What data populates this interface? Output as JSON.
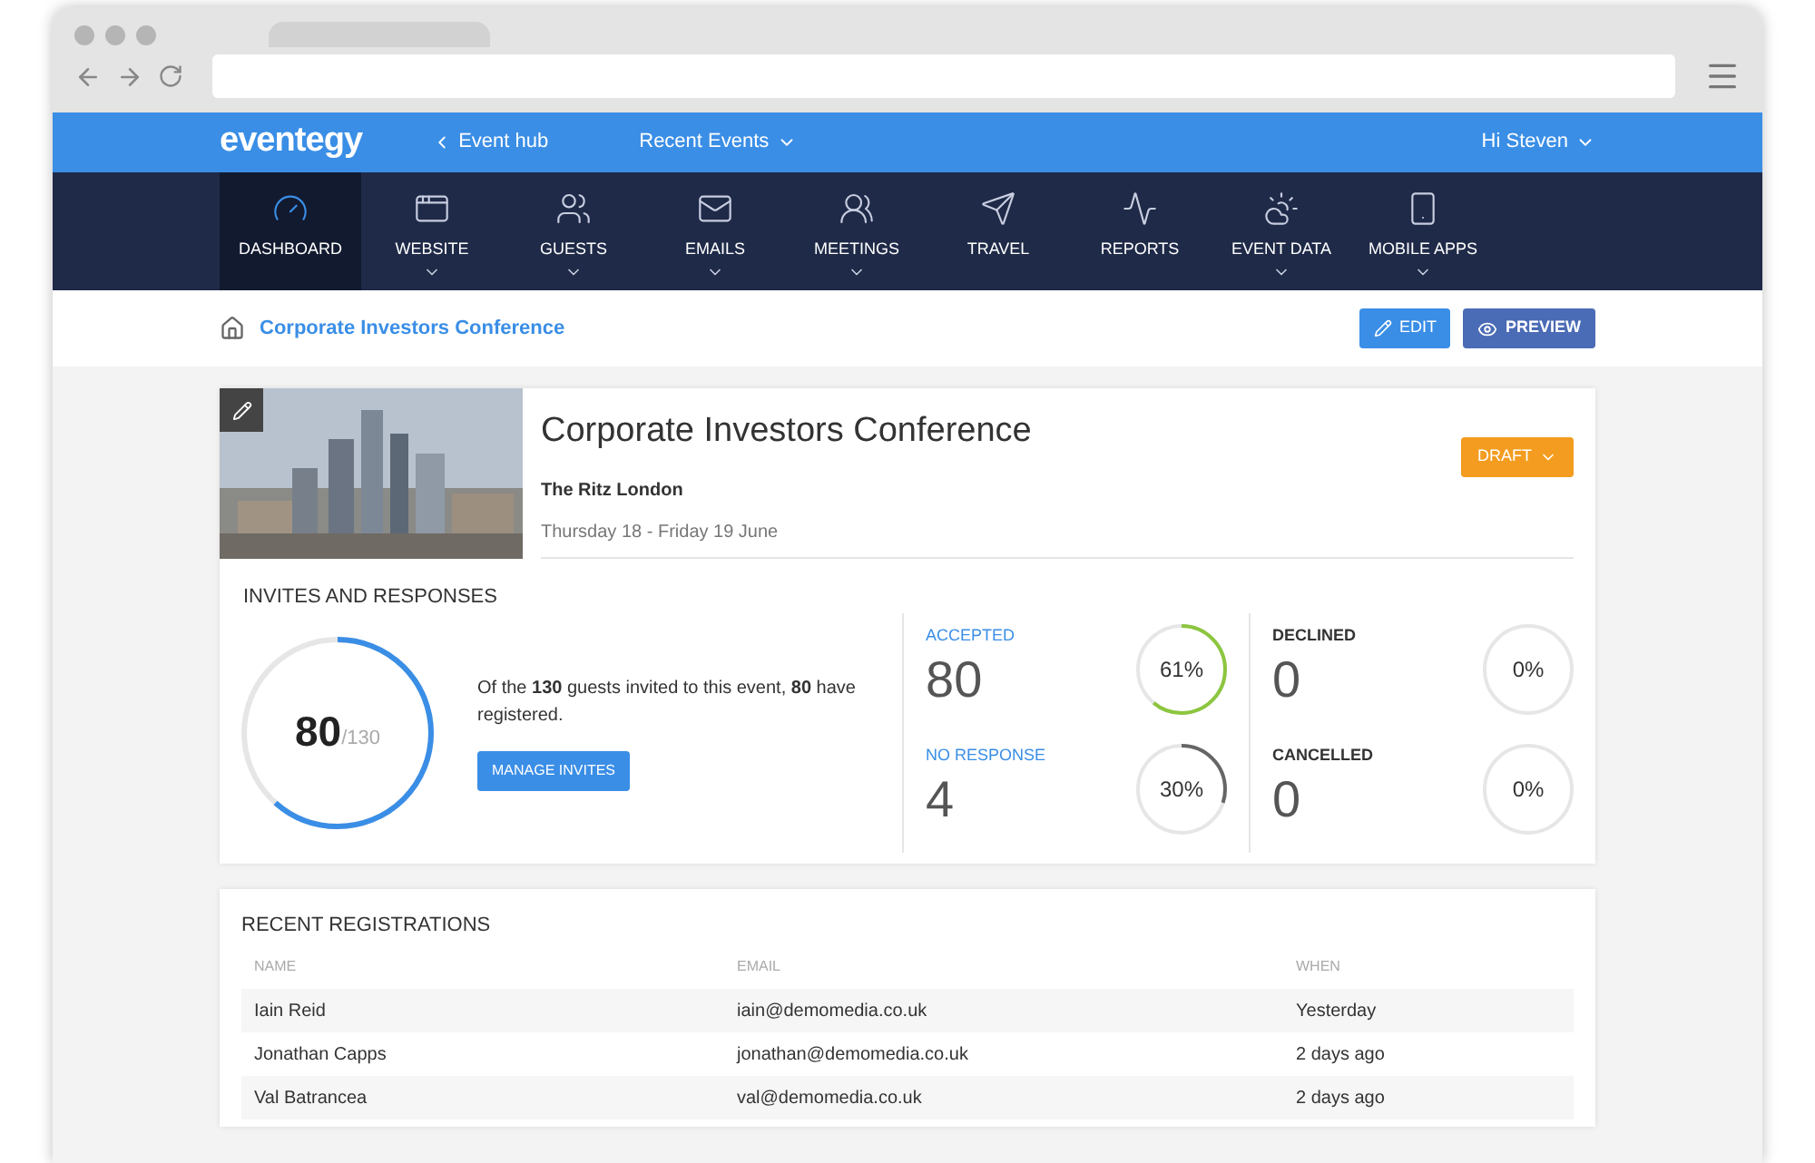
{
  "header": {
    "logo": "eventegy",
    "back_link": "Event hub",
    "recent_events": "Recent Events",
    "user": "Hi Steven"
  },
  "nav": [
    {
      "label": "DASHBOARD",
      "selected": true,
      "dropdown": false
    },
    {
      "label": "WEBSITE",
      "selected": false,
      "dropdown": true
    },
    {
      "label": "GUESTS",
      "selected": false,
      "dropdown": true
    },
    {
      "label": "EMAILS",
      "selected": false,
      "dropdown": true
    },
    {
      "label": "MEETINGS",
      "selected": false,
      "dropdown": true
    },
    {
      "label": "TRAVEL",
      "selected": false,
      "dropdown": false
    },
    {
      "label": "REPORTS",
      "selected": false,
      "dropdown": false
    },
    {
      "label": "EVENT DATA",
      "selected": false,
      "dropdown": true
    },
    {
      "label": "MOBILE APPS",
      "selected": false,
      "dropdown": true
    }
  ],
  "breadcrumb": "Corporate Investors Conference",
  "actions": {
    "edit": "EDIT",
    "preview": "PREVIEW"
  },
  "event": {
    "title": "Corporate Investors Conference",
    "venue": "The Ritz London",
    "dates": "Thursday 18 - Friday 19 June",
    "status": "DRAFT"
  },
  "invites": {
    "heading": "INVITES AND RESPONSES",
    "registered": "80",
    "total": "/130",
    "level": 0.615,
    "summary": "Of the **130** guests invited to this event, **80** have registered.",
    "button": "MANAGE INVITES",
    "stats": [
      {
        "label": "ACCEPTED",
        "value": "80",
        "percent": "61%",
        "level": 0.61,
        "color": "#8cc63f",
        "highlight": true
      },
      {
        "label": "DECLINED",
        "value": "0",
        "percent": "0%",
        "level": 0,
        "highlight": false
      },
      {
        "label": "NO RESPONSE",
        "value": "4",
        "percent": "30%",
        "level": 0.3,
        "color": "#666666",
        "highlight": true
      },
      {
        "label": "CANCELLED",
        "value": "0",
        "percent": "0%",
        "level": 0,
        "highlight": false
      }
    ]
  },
  "registrations": {
    "heading": "RECENT REGISTRATIONS",
    "columns": [
      "NAME",
      "EMAIL",
      "WHEN"
    ],
    "rows": [
      [
        "Iain Reid",
        "iain@demomedia.co.uk",
        "Yesterday"
      ],
      [
        "Jonathan Capps",
        "jonathan@demomedia.co.uk",
        "2 days ago"
      ],
      [
        "Val Batrancea",
        "val@demomedia.co.uk",
        "2 days ago"
      ]
    ]
  }
}
